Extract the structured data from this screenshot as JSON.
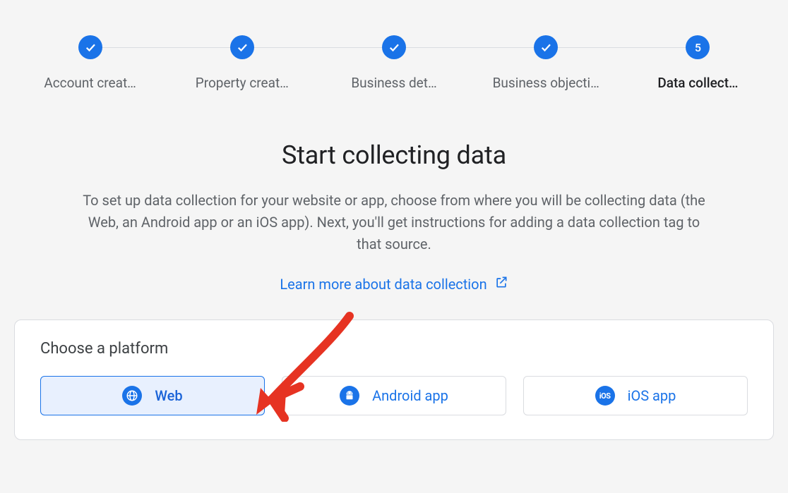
{
  "stepper": {
    "steps": [
      {
        "label": "Account creat…",
        "done": true
      },
      {
        "label": "Property creat…",
        "done": true
      },
      {
        "label": "Business det…",
        "done": true
      },
      {
        "label": "Business objecti…",
        "done": true
      },
      {
        "label": "Data collect…",
        "done": false,
        "current": true,
        "number": "5"
      }
    ]
  },
  "main": {
    "heading": "Start collecting data",
    "description": "To set up data collection for your website or app, choose from where you will be collecting data (the Web, an Android app or an iOS app). Next, you'll get instructions for adding a data collection tag to that source.",
    "learn_more_label": "Learn more about data collection"
  },
  "card": {
    "title": "Choose a platform",
    "platforms": [
      {
        "label": "Web",
        "icon": "globe-icon",
        "selected": true
      },
      {
        "label": "Android app",
        "icon": "android-icon",
        "selected": false
      },
      {
        "label": "iOS app",
        "icon": "ios-icon",
        "selected": false
      }
    ]
  },
  "colors": {
    "primary": "#1a73e8",
    "annotation": "#e63322"
  }
}
